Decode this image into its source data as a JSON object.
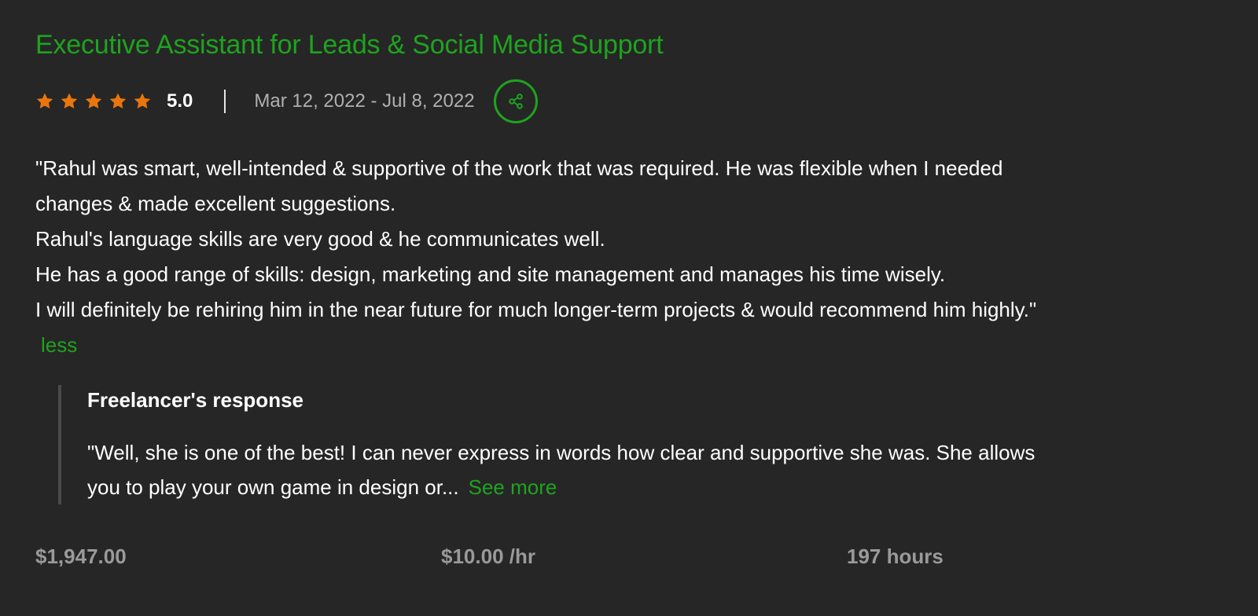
{
  "review": {
    "title": "Executive Assistant for Leads & Social Media Support",
    "rating_value": 5,
    "rating_text": "5.0",
    "date_range": "Mar 12, 2022 - Jul 8, 2022",
    "feedback_lines": [
      "\"Rahul was smart, well-intended & supportive of the work that was required. He was flexible when I needed",
      "changes & made excellent suggestions.",
      "Rahul's language skills are very good & he communicates well.",
      "He has a good range of skills: design, marketing and site management and manages his time wisely.",
      "I will definitely be rehiring him in the near future for much longer-term projects & would recommend him highly.\""
    ],
    "less_label": "less"
  },
  "response": {
    "title": "Freelancer's response",
    "text_lines": [
      "\"Well, she is one of the best! I can never express in words how clear and supportive she was. She allows",
      "you to play your own game in design or..."
    ],
    "see_more_label": "See more"
  },
  "stats": {
    "total_earned": "$1,947.00",
    "hourly_rate": "$10.00 /hr",
    "hours": "197 hours"
  },
  "icons": {
    "star": "star-icon",
    "share": "share-icon"
  },
  "colors": {
    "background": "#262626",
    "accent_green": "#1ea31e",
    "star_orange": "#e8750e",
    "muted_text": "#b0b0b0",
    "stat_text": "#9a9a9a"
  }
}
